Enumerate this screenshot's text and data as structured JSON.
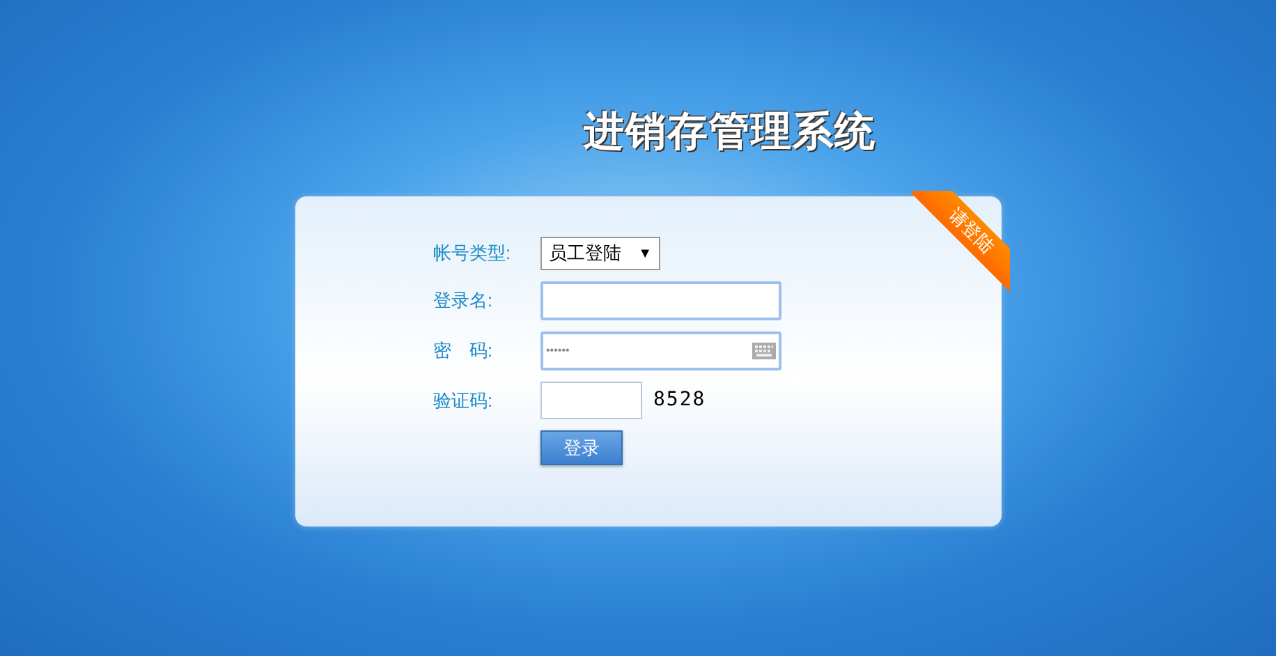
{
  "title": "进销存管理系统",
  "ribbon": {
    "label": "请登陆"
  },
  "form": {
    "fields": [
      {
        "kind": "select",
        "label": "帐号类型:",
        "value": "员工登陆",
        "caret": "▼"
      },
      {
        "kind": "text",
        "label": "登录名:"
      },
      {
        "kind": "password",
        "label": "密　码:",
        "value": "••••••"
      },
      {
        "kind": "captcha",
        "label": "验证码:",
        "code": "8528"
      }
    ],
    "submit": "登录"
  }
}
